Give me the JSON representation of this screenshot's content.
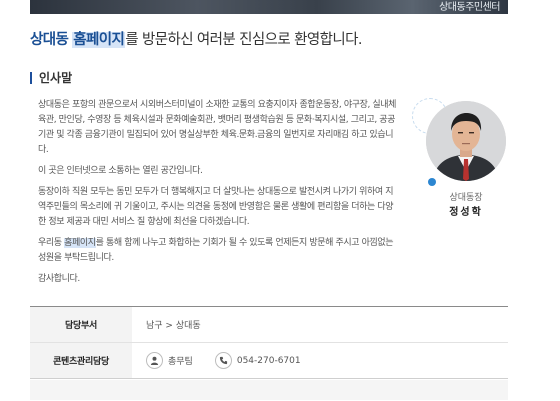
{
  "banner": {
    "text": "상대동주민센터"
  },
  "headline": {
    "place": "상대동",
    "highlight": "홈페이지",
    "rest": "를 방문하신 여러분 진심으로 환영합니다."
  },
  "greeting": {
    "title": "인사말",
    "paragraphs": [
      "상대동은 포항의 관문으로서 시외버스터미널이 소재한 교통의 요충지이자 종합운동장, 야구장, 실내체육관, 만인당, 수영장 등 체육시설과 문화예술회관, 뱃머리 평생학습원 등 문화·복지시설, 그리고, 공공기관 및 각종 금융기관이 밀집되어 있어 명실상부한 체육.문화.금융의 일번지로 자리매김 하고 있습니다.",
      "이 곳은 인터넷으로 소통하는 열린 공간입니다.",
      "동장이하 직원 모두는 동민 모두가 더 행복해지고 더 살맛나는 상대동으로 발전시켜 나가기 위하여 지역주민들의 목소리에 귀 기울이고, 주시는 의견을 동정에 반영함은 물론 생활에 편리함을 더하는 다양한 정보 제공과 대민 서비스 질 향상에 최선을 다하겠습니다."
    ],
    "p4_before": "우리동 ",
    "p4_highlight": "홈페이지",
    "p4_after": "를 통해 함께 나누고 화합하는 기회가 될 수 있도록 언제든지 방문해 주시고 아낌없는 성원을 부탁드립니다.",
    "closing": "감사합니다."
  },
  "profile": {
    "role": "상대동장",
    "name": "정성학"
  },
  "info": {
    "dept_label": "담당부서",
    "dept_value": "남구 > 상대동",
    "manager_label": "콘텐츠관리담당",
    "manager_name": "총무팀",
    "manager_phone": "054-270-6701"
  },
  "colors": {
    "accent": "#1a4f94",
    "highlight_bg": "#d6e4f7"
  },
  "icons": {
    "person": "person-icon",
    "phone": "phone-icon"
  }
}
